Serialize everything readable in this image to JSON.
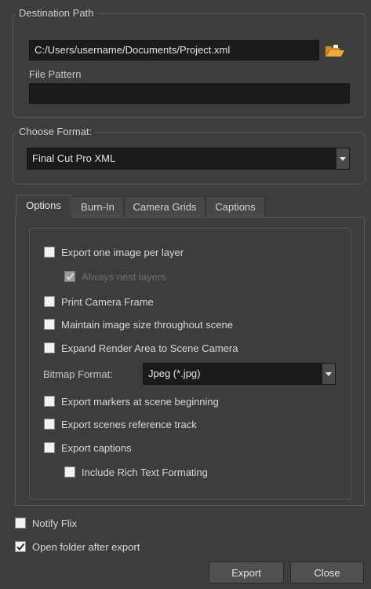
{
  "destination": {
    "title": "Destination Path",
    "path_value": "C:/Users/username/Documents/Project.xml",
    "browse_icon": "folder-open-icon",
    "file_pattern_label": "File Pattern",
    "file_pattern_value": ""
  },
  "format": {
    "title": "Choose Format:",
    "selected": "Final Cut Pro XML"
  },
  "tabs": [
    {
      "label": "Options",
      "active": true
    },
    {
      "label": "Burn-In",
      "active": false
    },
    {
      "label": "Camera Grids",
      "active": false
    },
    {
      "label": "Captions",
      "active": false
    }
  ],
  "options": {
    "export_one_image": {
      "label": "Export one image per layer",
      "checked": false
    },
    "always_nest": {
      "label": "Always nest layers",
      "checked": true,
      "disabled": true
    },
    "print_camera_frame": {
      "label": "Print Camera Frame",
      "checked": false
    },
    "maintain_image_size": {
      "label": "Maintain image size throughout scene",
      "checked": false
    },
    "expand_render_area": {
      "label": "Expand Render Area to Scene Camera",
      "checked": false
    },
    "bitmap_format_label": "Bitmap Format:",
    "bitmap_format_value": "Jpeg (*.jpg)",
    "export_markers": {
      "label": "Export markers at scene beginning",
      "checked": false
    },
    "export_reference_track": {
      "label": "Export scenes reference track",
      "checked": false
    },
    "export_captions": {
      "label": "Export captions",
      "checked": false
    },
    "include_rich_text": {
      "label": "Include Rich Text Formating",
      "checked": false
    }
  },
  "footer": {
    "notify_flix": {
      "label": "Notify Flix",
      "checked": false
    },
    "open_folder": {
      "label": "Open folder after export",
      "checked": true
    },
    "export_button": "Export",
    "close_button": "Close"
  }
}
